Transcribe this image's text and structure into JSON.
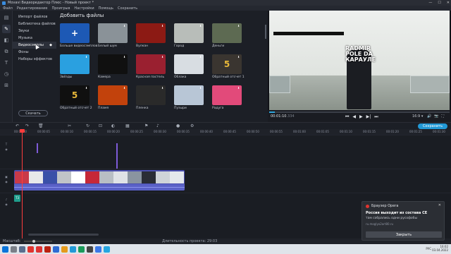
{
  "window": {
    "title": "Movavi Видеоредактор Плюс - Новый проект *",
    "controls": [
      "—",
      "☐",
      "✕"
    ]
  },
  "menu": [
    "Файл",
    "Редактирование",
    "Проигрыв",
    "Настройки",
    "Помощь",
    "Сохранить"
  ],
  "categories": [
    {
      "label": "Импорт файлов"
    },
    {
      "label": "Библиотека файлов"
    },
    {
      "label": "Звуки"
    },
    {
      "label": "Музыка"
    },
    {
      "label": "Видеосэмплы",
      "selected": true
    },
    {
      "label": "Фоны"
    },
    {
      "label": "Наборы эффектов"
    }
  ],
  "search_label": "Скачать",
  "content_title": "Добавить файлы",
  "tiles": [
    {
      "label": "Больше видеосэмплов",
      "color": "#1d59b5",
      "icon": "+"
    },
    {
      "label": "Белый шум",
      "color": "#8a9298"
    },
    {
      "label": "Вулкан",
      "color": "#8c1a14"
    },
    {
      "label": "Город",
      "color": "#b8bdb9"
    },
    {
      "label": "Деньги",
      "color": "#5d6a52"
    },
    {
      "label": "Звёзды",
      "color": "#2aa0e0"
    },
    {
      "label": "Камера",
      "color": "#101010"
    },
    {
      "label": "Красная пастель",
      "color": "#9a2030"
    },
    {
      "label": "Облака",
      "color": "#d8dde2"
    },
    {
      "label": "Обратный отсчет 1",
      "color": "#3a3530",
      "icon": "5"
    },
    {
      "label": "Обратный отсчет 2",
      "color": "#101010",
      "icon": "5"
    },
    {
      "label": "Пламя",
      "color": "#c2420c"
    },
    {
      "label": "Пленка",
      "color": "#2a2a2a"
    },
    {
      "label": "Пузыри",
      "color": "#b8c6d6"
    },
    {
      "label": "Радуга",
      "color": "#e24a7a"
    }
  ],
  "preview": {
    "watermark": "RADMIR\nPOLE DA\nКАРАУЛЕ",
    "timecode": "00:01:10",
    "timecode_frames": ".334",
    "progress_fraction": 0.03,
    "aspect": "16:9 ▾",
    "controls": [
      "⏮",
      "◀",
      "▶",
      "▶|",
      "⏭"
    ],
    "right_icons": [
      "🔊",
      "📷",
      "⛶"
    ]
  },
  "toolbar": {
    "save_label": "Сохранить"
  },
  "ruler_ticks": [
    "00:00:00",
    "00:00:05",
    "00:00:10",
    "00:00:15",
    "00:00:20",
    "00:00:25",
    "00:00:30",
    "00:00:35",
    "00:00:40",
    "00:00:45",
    "00:00:50",
    "00:00:55",
    "00:01:00",
    "00:01:05",
    "00:01:10",
    "00:01:15",
    "00:01:20",
    "00:01:25",
    "00:01:30"
  ],
  "audio_clip_label": "Т3",
  "status": {
    "scale_label": "Масштаб:",
    "duration_label": "Длительность проекта: 29:03"
  },
  "toast": {
    "app": "Браузер Opera",
    "title": "Россия выходит из состава СЕ",
    "body": "там собрались одни русофобы",
    "url": "ru.moglyo2art80.ru",
    "button": "Закрыть",
    "close": "✕"
  },
  "tray": {
    "time": "16:02",
    "date": "03.04.2022",
    "lang": "РУС"
  }
}
